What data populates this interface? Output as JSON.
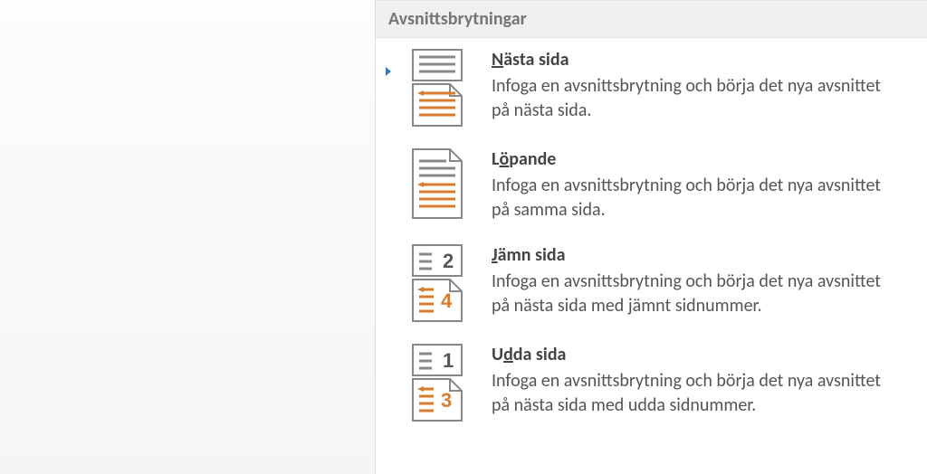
{
  "menu": {
    "section_header": "Avsnittsbrytningar",
    "items": [
      {
        "title_pre": "",
        "accel": "N",
        "title_post": "ästa sida",
        "desc": "Infoga en avsnittsbrytning och börja det nya avsnittet på nästa sida.",
        "selected": true
      },
      {
        "title_pre": "L",
        "accel": "ö",
        "title_post": "pande",
        "desc": "Infoga en avsnittsbrytning och börja det nya avsnittet på samma sida.",
        "selected": false
      },
      {
        "title_pre": "",
        "accel": "J",
        "title_post": "ämn sida",
        "desc": "Infoga en avsnittsbrytning och börja det nya avsnittet på nästa sida med jämnt sidnummer.",
        "selected": false
      },
      {
        "title_pre": "U",
        "accel": "d",
        "title_post": "da sida",
        "desc": "Infoga en avsnittsbrytning och börja det nya avsnittet på nästa sida med udda sidnummer.",
        "selected": false
      }
    ]
  }
}
